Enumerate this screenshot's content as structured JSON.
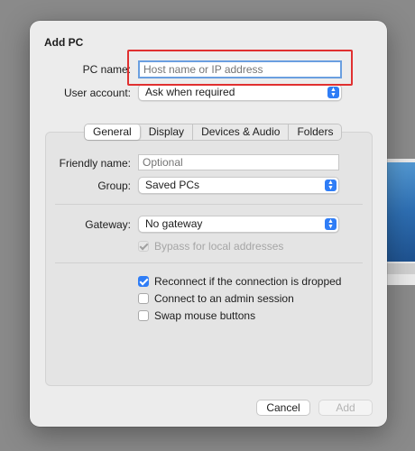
{
  "dialog": {
    "title": "Add PC",
    "pc_name_label": "PC name:",
    "pc_name_placeholder": "Host name or IP address",
    "pc_name_value": "",
    "user_account_label": "User account:",
    "user_account_value": "Ask when required",
    "tabs": [
      {
        "label": "General",
        "active": true
      },
      {
        "label": "Display",
        "active": false
      },
      {
        "label": "Devices & Audio",
        "active": false
      },
      {
        "label": "Folders",
        "active": false
      }
    ],
    "friendly_name_label": "Friendly name:",
    "friendly_name_placeholder": "Optional",
    "group_label": "Group:",
    "group_value": "Saved PCs",
    "gateway_label": "Gateway:",
    "gateway_value": "No gateway",
    "bypass_label": "Bypass for local addresses",
    "bypass_checked": true,
    "bypass_enabled": false,
    "reconnect_label": "Reconnect if the connection is dropped",
    "reconnect_checked": true,
    "admin_label": "Connect to an admin session",
    "admin_checked": false,
    "swap_label": "Swap mouse buttons",
    "swap_checked": false,
    "cancel_label": "Cancel",
    "add_label": "Add"
  },
  "colors": {
    "accent": "#2f7df6",
    "highlight_box": "#e03030"
  },
  "icons": {
    "popup": "chevron-updown-icon",
    "check": "checkmark-icon"
  }
}
